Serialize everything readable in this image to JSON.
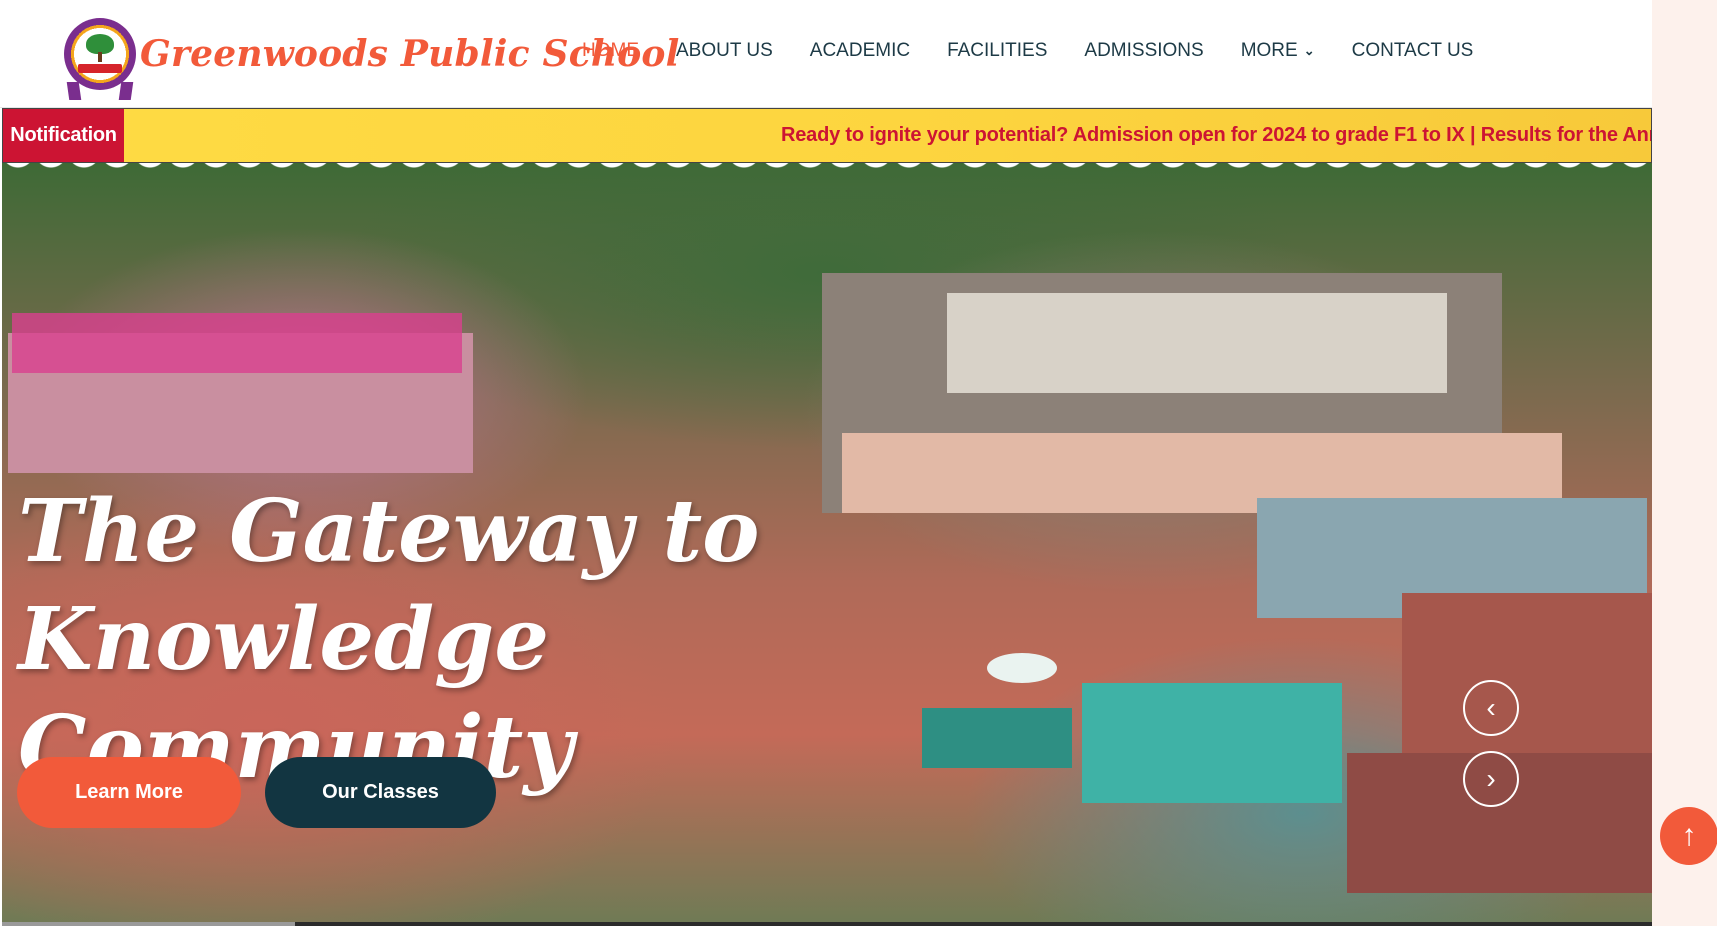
{
  "header": {
    "school_name": "Greenwoods Public School",
    "logo_icon": "school-seal-logo",
    "nav": [
      {
        "label": "HOME",
        "active": true
      },
      {
        "label": "ABOUT US",
        "active": false
      },
      {
        "label": "ACADEMIC",
        "active": false
      },
      {
        "label": "FACILITIES",
        "active": false
      },
      {
        "label": "ADMISSIONS",
        "active": false
      },
      {
        "label": "MORE",
        "active": false,
        "icon": "chevron-down-icon"
      },
      {
        "label": "CONTACT US",
        "active": false
      }
    ]
  },
  "notification": {
    "label": "Notification",
    "text": "Ready to ignite your potential? Admission open for 2024 to grade F1 to IX | Results for the Annual Examin:"
  },
  "hero": {
    "title_line1": "The Gateway to Knowledge",
    "title_line2": "Community",
    "learn_more": "Learn More",
    "our_classes": "Our Classes",
    "prev_icon": "chevron-left-icon",
    "next_icon": "chevron-right-icon"
  },
  "scroll_top_icon": "arrow-up-icon",
  "colors": {
    "accent": "#f25a3a",
    "dark": "#123541",
    "notif_red": "#cc1433",
    "notif_yellow": "#fdd53f"
  }
}
